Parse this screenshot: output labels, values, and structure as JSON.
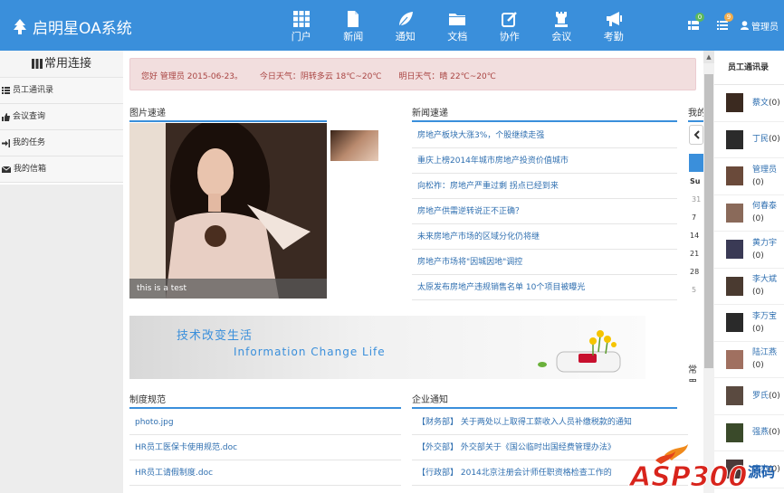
{
  "app": {
    "title": "启明星OA系统"
  },
  "nav": [
    {
      "label": "门户",
      "icon": "grid-icon"
    },
    {
      "label": "新闻",
      "icon": "file-icon"
    },
    {
      "label": "通知",
      "icon": "leaf-icon"
    },
    {
      "label": "文档",
      "icon": "folder-icon"
    },
    {
      "label": "协作",
      "icon": "edit-icon"
    },
    {
      "label": "会议",
      "icon": "rook-icon"
    },
    {
      "label": "考勤",
      "icon": "megaphone-icon"
    }
  ],
  "topbar": {
    "badge_apps": "0",
    "badge_list": "9",
    "admin_label": "管理员"
  },
  "sidebar": {
    "title": "常用连接",
    "items": [
      {
        "label": "员工通讯录",
        "icon": "list-icon"
      },
      {
        "label": "会议查询",
        "icon": "thumbs-up-icon"
      },
      {
        "label": "我的任务",
        "icon": "login-icon"
      },
      {
        "label": "我的信箱",
        "icon": "envelope-icon"
      }
    ]
  },
  "greeting": {
    "hello": "您好 管理员 2015-06-23。",
    "today": "今日天气：阴转多云 18℃~20℃",
    "tomorrow": "明日天气：晴 22℃~20℃"
  },
  "sections": {
    "photos": "图片速递",
    "news": "新闻速递",
    "mine": "我的",
    "rules": "制度规范",
    "notices": "企业通知",
    "common": "常用"
  },
  "photo": {
    "caption": "this is a test"
  },
  "news": [
    "房地产板块大涨3%，个股继续走强",
    "重庆上榜2014年城市房地产投资价值城市",
    "向松祚：房地产严重过剩 拐点已经到来",
    "房地产供需逆转说正不正确？",
    "未来房地产市场的区域分化仍将继",
    "房地产市场将\"因城因地\"调控",
    "太原发布房地产违规销售名单 10个项目被曝光"
  ],
  "banner": {
    "cn": "技术改变生活",
    "en": "Information Change Life"
  },
  "documents": [
    "photo.jpg",
    "HR员工医保卡使用规范.doc",
    "HR员工请假制度.doc"
  ],
  "notices": [
    "【财务部】 关于两处以上取得工薪收入人员补缴税款的通知",
    "【外交部】 外交部关于《国公临时出国经费管理办法》",
    "【行政部】 2014北京注册会计师任职资格检查工作的"
  ],
  "calendar": {
    "day_header": "Su",
    "days": [
      "31",
      "7",
      "14",
      "21",
      "28",
      "5"
    ]
  },
  "contacts": {
    "title": "员工通讯录",
    "list": [
      {
        "name": "蔡文",
        "count": "(0)",
        "sub": ""
      },
      {
        "name": "丁民",
        "count": "(0)",
        "sub": ""
      },
      {
        "name": "管理员",
        "count": "",
        "sub": "(0)"
      },
      {
        "name": "何春泰",
        "count": "",
        "sub": "(0)"
      },
      {
        "name": "黄力宇",
        "count": "",
        "sub": "(0)"
      },
      {
        "name": "李大斌",
        "count": "",
        "sub": "(0)"
      },
      {
        "name": "李万宝",
        "count": "",
        "sub": "(0)"
      },
      {
        "name": "陆江燕",
        "count": "",
        "sub": "(0)"
      },
      {
        "name": "罗氏",
        "count": "(0)",
        "sub": ""
      },
      {
        "name": "强燕",
        "count": "(0)",
        "sub": ""
      },
      {
        "name": "唐杰",
        "count": "(0)",
        "sub": ""
      }
    ]
  },
  "watermark": {
    "text": "ASP300",
    "suffix": "源码"
  },
  "colors": {
    "primary": "#3a8fdb",
    "alert_bg": "#f2dede",
    "alert_text": "#a94442",
    "link": "#2f6fb0"
  }
}
